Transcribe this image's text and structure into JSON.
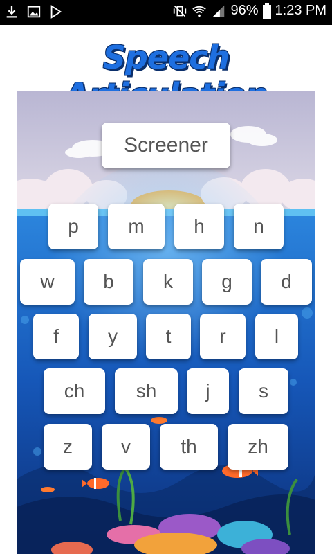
{
  "status_bar": {
    "battery": "96%",
    "time": "1:23 PM"
  },
  "app": {
    "title": "Speech Articulation"
  },
  "screener_label": "Screener",
  "sounds": {
    "row1": [
      "p",
      "m",
      "h",
      "n"
    ],
    "row2": [
      "w",
      "b",
      "k",
      "g",
      "d"
    ],
    "row3": [
      "f",
      "y",
      "t",
      "r",
      "l"
    ],
    "row4": [
      "ch",
      "sh",
      "j",
      "s"
    ],
    "row5": [
      "z",
      "v",
      "th",
      "zh"
    ]
  },
  "colors": {
    "title_blue": "#1e6fe0",
    "sky": "#c9c7dd",
    "ocean": "#1b64c4",
    "deep_ocean": "#0f3d8c",
    "button_text": "#555555"
  }
}
